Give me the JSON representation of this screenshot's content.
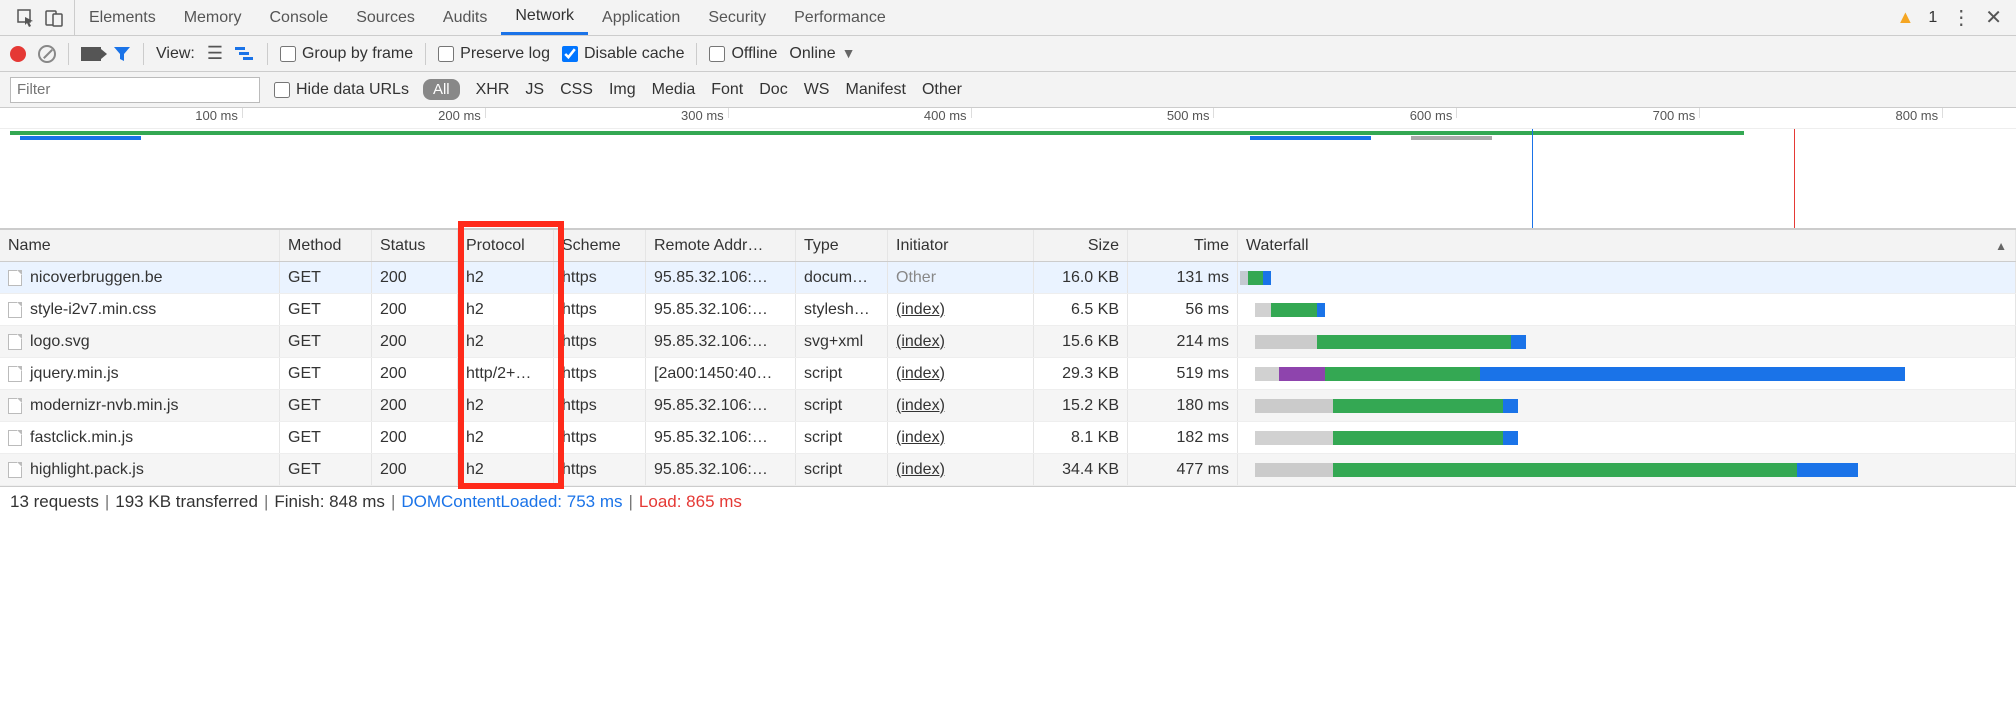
{
  "tabs": [
    "Elements",
    "Memory",
    "Console",
    "Sources",
    "Audits",
    "Network",
    "Application",
    "Security",
    "Performance"
  ],
  "active_tab": "Network",
  "warnings_count": "1",
  "toolbar": {
    "view_label": "View:",
    "group_by_frame": "Group by frame",
    "preserve_log": "Preserve log",
    "disable_cache": "Disable cache",
    "offline": "Offline",
    "online": "Online"
  },
  "filter": {
    "placeholder": "Filter",
    "hide_data_urls": "Hide data URLs",
    "types": [
      "All",
      "XHR",
      "JS",
      "CSS",
      "Img",
      "Media",
      "Font",
      "Doc",
      "WS",
      "Manifest",
      "Other"
    ],
    "active_type": "All"
  },
  "ruler_ticks": [
    "100 ms",
    "200 ms",
    "300 ms",
    "400 ms",
    "500 ms",
    "600 ms",
    "700 ms",
    "800 ms"
  ],
  "columns": [
    "Name",
    "Method",
    "Status",
    "Protocol",
    "Scheme",
    "Remote Addr…",
    "Type",
    "Initiator",
    "Size",
    "Time",
    "Waterfall"
  ],
  "rows": [
    {
      "name": "nicoverbruggen.be",
      "method": "GET",
      "status": "200",
      "protocol": "h2",
      "scheme": "https",
      "remote": "95.85.32.106:…",
      "type": "docum…",
      "initiator": "Other",
      "initiator_link": false,
      "size": "16.0 KB",
      "time": "131 ms",
      "wf": {
        "start": 0,
        "wait": 1,
        "ttfb": 2,
        "dl": 1
      }
    },
    {
      "name": "style-i2v7.min.css",
      "method": "GET",
      "status": "200",
      "protocol": "h2",
      "scheme": "https",
      "remote": "95.85.32.106:…",
      "type": "stylesh…",
      "initiator": "(index)",
      "initiator_link": true,
      "size": "6.5 KB",
      "time": "56 ms",
      "wf": {
        "start": 2,
        "wait": 2,
        "ttfb": 6,
        "dl": 1
      }
    },
    {
      "name": "logo.svg",
      "method": "GET",
      "status": "200",
      "protocol": "h2",
      "scheme": "https",
      "remote": "95.85.32.106:…",
      "type": "svg+xml",
      "initiator": "(index)",
      "initiator_link": true,
      "size": "15.6 KB",
      "time": "214 ms",
      "wf": {
        "start": 2,
        "wait": 8,
        "ttfb": 25,
        "dl": 2
      }
    },
    {
      "name": "jquery.min.js",
      "method": "GET",
      "status": "200",
      "protocol": "http/2+…",
      "scheme": "https",
      "remote": "[2a00:1450:40…",
      "type": "script",
      "initiator": "(index)",
      "initiator_link": true,
      "size": "29.3 KB",
      "time": "519 ms",
      "wf": {
        "start": 2,
        "wait": 3,
        "dns": 6,
        "ttfb": 20,
        "dl": 55
      }
    },
    {
      "name": "modernizr-nvb.min.js",
      "method": "GET",
      "status": "200",
      "protocol": "h2",
      "scheme": "https",
      "remote": "95.85.32.106:…",
      "type": "script",
      "initiator": "(index)",
      "initiator_link": true,
      "size": "15.2 KB",
      "time": "180 ms",
      "wf": {
        "start": 2,
        "wait": 10,
        "ttfb": 22,
        "dl": 2
      }
    },
    {
      "name": "fastclick.min.js",
      "method": "GET",
      "status": "200",
      "protocol": "h2",
      "scheme": "https",
      "remote": "95.85.32.106:…",
      "type": "script",
      "initiator": "(index)",
      "initiator_link": true,
      "size": "8.1 KB",
      "time": "182 ms",
      "wf": {
        "start": 2,
        "wait": 10,
        "ttfb": 22,
        "dl": 2
      }
    },
    {
      "name": "highlight.pack.js",
      "method": "GET",
      "status": "200",
      "protocol": "h2",
      "scheme": "https",
      "remote": "95.85.32.106:…",
      "type": "script",
      "initiator": "(index)",
      "initiator_link": true,
      "size": "34.4 KB",
      "time": "477 ms",
      "wf": {
        "start": 2,
        "wait": 10,
        "ttfb": 60,
        "dl": 8
      }
    }
  ],
  "status": {
    "requests": "13 requests",
    "transferred": "193 KB transferred",
    "finish": "Finish: 848 ms",
    "dcl_label": "DOMContentLoaded: 753 ms",
    "load_label": "Load: 865 ms"
  }
}
